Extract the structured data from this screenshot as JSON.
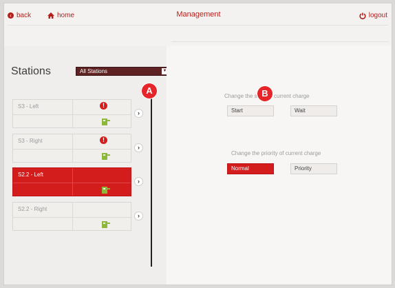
{
  "header": {
    "back_label": "back",
    "home_label": "home",
    "title": "Management",
    "logout_label": "logout"
  },
  "stations_panel": {
    "title": "Stations",
    "filter_value": "All Stations",
    "items": [
      {
        "name": "S3 - Left",
        "warning": true,
        "active": false
      },
      {
        "name": "S3 - Right",
        "warning": true,
        "active": false
      },
      {
        "name": "S2.2 - Left",
        "warning": false,
        "active": true
      },
      {
        "name": "S2.2 - Right",
        "warning": false,
        "active": false
      }
    ]
  },
  "controls": {
    "state_label": "Change the state of current charge",
    "start_label": "Start",
    "wait_label": "Wait",
    "priority_section_label": "Change the priority of current charge",
    "normal_label": "Normal",
    "priority_label": "Priority"
  },
  "annotations": {
    "a": "A",
    "b": "B"
  },
  "colors": {
    "accent": "#d31d1d",
    "dark": "#5e2222"
  }
}
